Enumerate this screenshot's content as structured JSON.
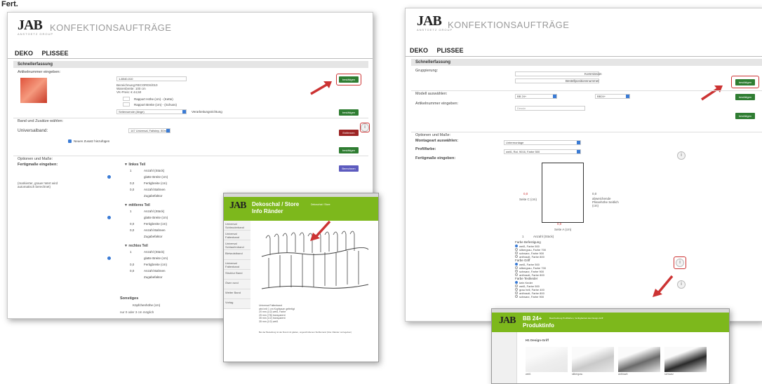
{
  "corner_label": "Fert.",
  "left": {
    "logo": "JAB",
    "logo_sub": "ANSTOETZ GROUP",
    "title": "KONFEKTIONSAUFTRÄGE",
    "nav": [
      "DEKO",
      "PLISSEE"
    ],
    "section": "Schnellerfassung",
    "article_label": "Artikelnummer eingeben:",
    "article_value": "1-8040-010",
    "article_info": [
      "Bezeichnung:RECORDS/010",
      "Warenbreite: 100 cm",
      "VK-Preis: € 44,50"
    ],
    "rapport_hoehe": "Rapport Höhe (cm) - (Kette)",
    "rapport_breite": "Rapport Breite (cm) - (Schuss)",
    "select_length": "Seitenwende (länge)",
    "select_processing": "Verarbeitungsrichtung",
    "btn_confirm": "bestätigen",
    "band_label": "Band und Zusätze wählen:",
    "universal_label": "Universalband:",
    "universal_value": "147 Universal, Faltstep. 80mm",
    "btn_remove": "Entfernen",
    "add_extra": "Neuen Zusatz hinzufügen",
    "options_label": "Optionen und Maße:",
    "fertig_label": "Fertigmaße eingeben:",
    "hint": "(markierter, grauer Wert wird automatisch berechnet)",
    "btn_calc": "Berechnen",
    "parts": [
      {
        "title": "▼ linkes Teil",
        "rows": [
          "Anzahl (Stück)",
          "glatte Breite (cm)",
          "Fertigbreite (cm)",
          "Anzahl Bahnen",
          "Zugabefaktor"
        ],
        "vals": [
          "1",
          "",
          "0,0",
          "0,0",
          ""
        ]
      },
      {
        "title": "▼ mittleres Teil",
        "rows": [
          "Anzahl (Stück)",
          "glatte Breite (cm)",
          "Fertigbreite (cm)",
          "Anzahl Bahnen",
          "Zugabefaktor"
        ],
        "vals": [
          "1",
          "",
          "0,0",
          "0,0",
          ""
        ]
      },
      {
        "title": "▼ rechtes Teil",
        "rows": [
          "Anzahl (Stück)",
          "glatte Breite (cm)",
          "Fertigbreite (cm)",
          "Anzahl Bahnen",
          "Zugabefaktor"
        ],
        "vals": [
          "1",
          "",
          "0,0",
          "0,0",
          ""
        ]
      }
    ],
    "sonstiges": "Sonstiges",
    "kopfhoehe": "Köpfchenhöhe (cm)",
    "note": "nur 0 oder 3 cm möglich"
  },
  "popup_left": {
    "logo": "JAB",
    "title": "Dekoschal / Store",
    "title_tag": "Dekoschal / Store",
    "subtitle": "Info Ränder",
    "side_items": [
      "Universal Schleuderband",
      "Universal Faltenband",
      "Universal Schlaufenband",
      "Bleiwulstband",
      "Universal Faltenband",
      "Struktur Band",
      "Ösen rund",
      "Weiter Band",
      "Vorlag"
    ],
    "caption": [
      "Universal Faltenband",
      "wird mit 1 cm Kopfsaum gefertigt",
      "20 mm (1/2) weiß, Farbe",
      "25 mm (7/8) transparent",
      "35 mm (1/2) transparent",
      "35 mm (1/2) weiß"
    ],
    "footnote": "Bei der Bestellung ist der Rand mit glatten, ungeschnittenen Stoffenrand (bzw. Ränder vorzugeben)"
  },
  "right": {
    "logo": "JAB",
    "logo_sub": "ANSTOETZ GROUP",
    "title": "KONFEKTIONSAUFTRÄGE",
    "nav": [
      "DEKO",
      "PLISSEE"
    ],
    "section": "Schnellerfassung",
    "gruppierung": "Gruppierung:",
    "kommission": "Kommission",
    "bestellposition": "Bestellpositionsnummer",
    "modell": "Modell auswählen:",
    "modell_a": "BB 24+",
    "modell_b": "BB24+",
    "artikel": "Artikelnummer eingeben:",
    "artikel_placeholder": "Dessin",
    "btn_confirm": "bestätigen",
    "options": "Optionen und Maße:",
    "montage": "Montageart auswählen:",
    "montage_val": "Untermontage",
    "profil": "Profilfarbe:",
    "profil_val": "weiß, Ral. 9016, Farbe 500",
    "fertig": "Fertigmaße eingeben:",
    "side_c_val": "0,0",
    "side_c": "Seite C (cm)",
    "side_right_val": "0,0",
    "side_right": "abweichende Plissehöhe Seitlich (cm)",
    "side_a_val": "0,0",
    "side_a": "Seite A (cm)",
    "anzahl": "Anzahl (Stück)",
    "anzahl_val": "1",
    "befestigung": "Farbe Befestigung",
    "bef_opts": [
      "weiß, Farbe 500",
      "silbergrau, Farbe 700",
      "schwarz, Farbe 900",
      "anthrazit, Farbe 800"
    ],
    "griff": "Farbe Griff",
    "griff_opts": [
      "weiß, Farbe 500",
      "silbergrau, Farbe 700",
      "schwarz, Farbe 900",
      "anthrazit, Farbe 800"
    ],
    "textkeder": "Farbe Textkeder",
    "keder_opts": [
      "kein Keder",
      "weiß, Farbe 500",
      "grau hell, Farbe 400",
      "anthrazit, Farbe 800",
      "schwarz, Farbe 900"
    ]
  },
  "popup_right": {
    "logo": "JAB",
    "title": "BB 24+",
    "subtitle": "Produktinfo",
    "small_desc": "Beschreibung Profilfarben, Verfügbarkeit des Design-Griff",
    "heading": "H1 Design-Griff",
    "swatches": [
      "weiß",
      "silbergrau",
      "anthrazit",
      "schwarz"
    ]
  },
  "colors": {
    "green": "#2f7d32",
    "red": "#c33333",
    "blue": "#3a7bd5",
    "lime": "#7db81c"
  }
}
